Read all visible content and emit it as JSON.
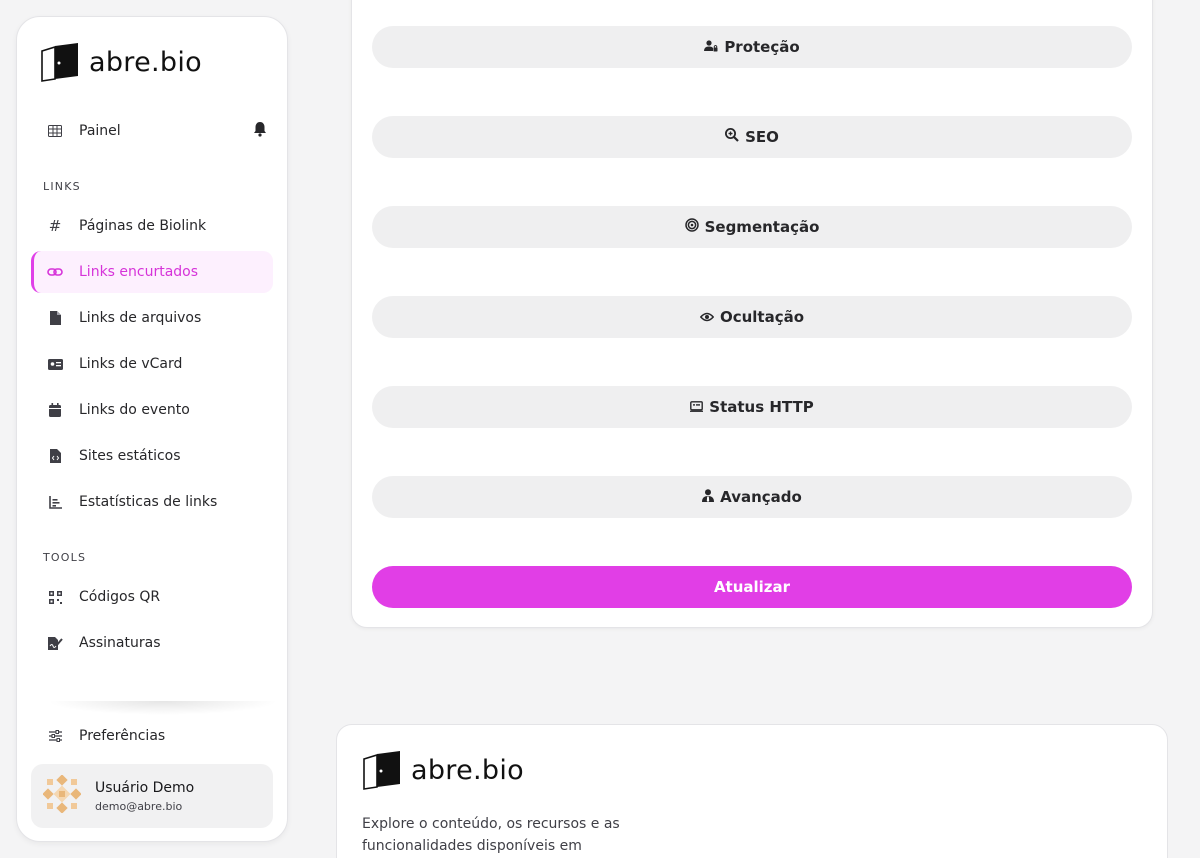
{
  "brand": {
    "name": "abre.bio"
  },
  "sidebar": {
    "dashboard": "Painel",
    "sections": {
      "links": "LINKS",
      "tools": "TOOLS"
    },
    "links_items": [
      {
        "label": "Páginas de Biolink",
        "icon": "hash-icon"
      },
      {
        "label": "Links encurtados",
        "icon": "link-icon",
        "active": true
      },
      {
        "label": "Links de arquivos",
        "icon": "file-icon"
      },
      {
        "label": "Links de vCard",
        "icon": "id-card-icon"
      },
      {
        "label": "Links do evento",
        "icon": "calendar-icon"
      },
      {
        "label": "Sites estáticos",
        "icon": "file-code-icon"
      },
      {
        "label": "Estatísticas de links",
        "icon": "bar-chart-icon"
      }
    ],
    "tools_items": [
      {
        "label": "Códigos QR",
        "icon": "qrcode-icon"
      },
      {
        "label": "Assinaturas",
        "icon": "signature-icon"
      }
    ],
    "preferences": "Preferências",
    "user": {
      "name": "Usuário Demo",
      "email": "demo@abre.bio"
    }
  },
  "form": {
    "sections": [
      {
        "label": "Proteção",
        "icon": "user-lock-icon"
      },
      {
        "label": "SEO",
        "icon": "search-plus-icon"
      },
      {
        "label": "Segmentação",
        "icon": "target-icon"
      },
      {
        "label": "Ocultação",
        "icon": "eye-icon"
      },
      {
        "label": "Status HTTP",
        "icon": "server-icon"
      },
      {
        "label": "Avançado",
        "icon": "user-tie-icon"
      }
    ],
    "submit_label": "Atualizar"
  },
  "footer": {
    "description": "Explore o conteúdo, os recursos e as funcionalidades disponíveis em"
  },
  "colors": {
    "accent": "#e13ee6",
    "active_bg": "#fdf0fe",
    "pill_bg": "#efeff0"
  }
}
